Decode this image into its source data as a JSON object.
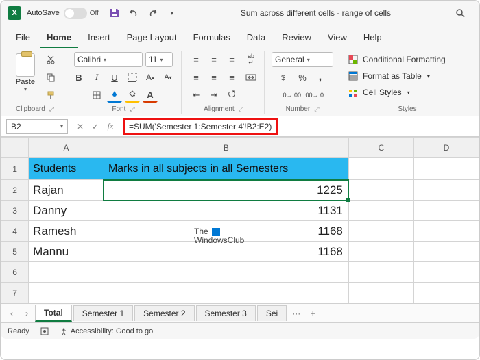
{
  "titlebar": {
    "autosave_label": "AutoSave",
    "autosave_state": "Off",
    "doc_title": "Sum across different cells - range of cells"
  },
  "menu": {
    "items": [
      "File",
      "Home",
      "Insert",
      "Page Layout",
      "Formulas",
      "Data",
      "Review",
      "View",
      "Help"
    ],
    "active": "Home"
  },
  "ribbon": {
    "clipboard": {
      "paste": "Paste",
      "label": "Clipboard"
    },
    "font": {
      "name": "Calibri",
      "size": "11",
      "bold": "B",
      "italic": "I",
      "underline": "U",
      "label": "Font"
    },
    "alignment": {
      "wrap": "ab",
      "label": "Alignment"
    },
    "number": {
      "format": "General",
      "percent": "%",
      "comma": ",",
      "label": "Number"
    },
    "styles": {
      "conditional": "Conditional Formatting",
      "table": "Format as Table",
      "cell": "Cell Styles",
      "label": "Styles"
    }
  },
  "formula_bar": {
    "cell_ref": "B2",
    "formula": "=SUM('Semester 1:Semester 4'!B2:E2)"
  },
  "grid": {
    "columns": [
      "A",
      "B",
      "C",
      "D"
    ],
    "header": {
      "A": "Students",
      "B": "Marks in all subjects in all Semesters"
    },
    "rows": [
      {
        "n": "1"
      },
      {
        "n": "2",
        "A": "Rajan",
        "B": "1225"
      },
      {
        "n": "3",
        "A": "Danny",
        "B": "1131"
      },
      {
        "n": "4",
        "A": "Ramesh",
        "B": "1168"
      },
      {
        "n": "5",
        "A": "Mannu",
        "B": "1168"
      },
      {
        "n": "6"
      },
      {
        "n": "7"
      }
    ],
    "watermark_l1": "The",
    "watermark_l2": "WindowsClub"
  },
  "tabs": {
    "items": [
      "Total",
      "Semester 1",
      "Semester 2",
      "Semester 3",
      "Sei"
    ],
    "active": "Total",
    "ellipsis": "···",
    "add": "+"
  },
  "status": {
    "ready": "Ready",
    "accessibility": "Accessibility: Good to go"
  }
}
